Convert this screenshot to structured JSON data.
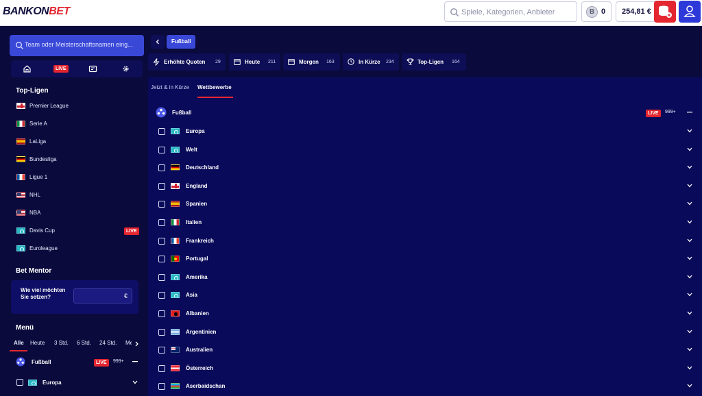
{
  "header": {
    "logo_main": "BANKON",
    "logo_accent": "BET",
    "search_placeholder": "Spiele, Kategorien, Anbieter",
    "coins_value": "0",
    "balance": "254,81 €"
  },
  "sidebar": {
    "search_placeholder": "Team oder Meisterschaftsnamen eing...",
    "quick_nav_live": "LIVE",
    "top_leagues_title": "Top-Ligen",
    "leagues": [
      {
        "name": "Premier League",
        "flag": "eng"
      },
      {
        "name": "Serie A",
        "flag": "ita"
      },
      {
        "name": "LaLiga",
        "flag": "esp"
      },
      {
        "name": "Bundesliga",
        "flag": "ger"
      },
      {
        "name": "Ligue 1",
        "flag": "fra"
      },
      {
        "name": "NHL",
        "flag": "usa"
      },
      {
        "name": "NBA",
        "flag": "usa"
      },
      {
        "name": "Davis Cup",
        "flag": "world",
        "badge": "LIVE"
      },
      {
        "name": "Euroleague",
        "flag": "world"
      }
    ],
    "bet_mentor_title": "Bet Mentor",
    "bet_mentor_question": "Wie viel möchten Sie setzen?",
    "stake_currency": "€",
    "menu_title": "Menü",
    "menu_tabs": [
      "Alle",
      "Heute",
      "3 Std.",
      "6 Std.",
      "24 Std.",
      "Me"
    ],
    "sport": {
      "name": "Fußball",
      "badge": "LIVE",
      "count": "999+"
    },
    "region": {
      "name": "Europa"
    }
  },
  "main": {
    "breadcrumb": "Fußball",
    "filters": [
      {
        "label": "Erhöhte Quoten",
        "count": "29"
      },
      {
        "label": "Heute",
        "count": "211"
      },
      {
        "label": "Morgen",
        "count": "163"
      },
      {
        "label": "In Kürze",
        "count": "234"
      },
      {
        "label": "Top-Ligen",
        "count": "164"
      }
    ],
    "sub_tabs": [
      "Jetzt & in Kürze",
      "Wettbewerbe"
    ],
    "sport": {
      "name": "Fußball",
      "badge": "LIVE",
      "count": "999+"
    },
    "regions": [
      {
        "name": "Europa",
        "flag": "world"
      },
      {
        "name": "Welt",
        "flag": "world"
      },
      {
        "name": "Deutschland",
        "flag": "ger"
      },
      {
        "name": "England",
        "flag": "eng"
      },
      {
        "name": "Spanien",
        "flag": "esp"
      },
      {
        "name": "Italien",
        "flag": "ita"
      },
      {
        "name": "Frankreich",
        "flag": "fra"
      },
      {
        "name": "Portugal",
        "flag": "por"
      },
      {
        "name": "Amerika",
        "flag": "world"
      },
      {
        "name": "Asia",
        "flag": "world"
      },
      {
        "name": "Albanien",
        "flag": "alb"
      },
      {
        "name": "Argentinien",
        "flag": "arg"
      },
      {
        "name": "Australien",
        "flag": "aus"
      },
      {
        "name": "Österreich",
        "flag": "aut"
      },
      {
        "name": "Aserbaidschan",
        "flag": "aze"
      }
    ]
  },
  "colors": {
    "accent_red": "#e3262f",
    "accent_blue": "#3a48d8",
    "background": "#0a0a3c"
  }
}
